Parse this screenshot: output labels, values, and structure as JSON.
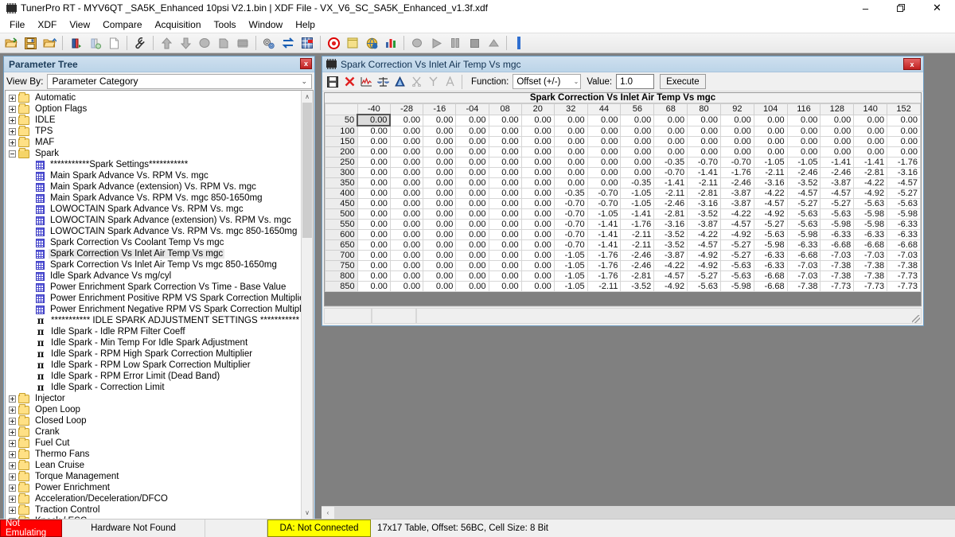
{
  "window": {
    "title": "TunerPro RT - MYV6QT  _SA5K_Enhanced 10psi V2.1.bin | XDF File - VX_V6_SC_SA5K_Enhanced_v1.3f.xdf",
    "app_icon": "chip-icon",
    "minimize_label": "–",
    "restore_label": "❐",
    "close_label": "✕"
  },
  "menu": {
    "items": [
      {
        "label": "File",
        "name": "menu-file"
      },
      {
        "label": "XDF",
        "name": "menu-xdf"
      },
      {
        "label": "View",
        "name": "menu-view"
      },
      {
        "label": "Compare",
        "name": "menu-compare"
      },
      {
        "label": "Acquisition",
        "name": "menu-acquisition"
      },
      {
        "label": "Tools",
        "name": "menu-tools"
      },
      {
        "label": "Window",
        "name": "menu-window"
      },
      {
        "label": "Help",
        "name": "menu-help"
      }
    ]
  },
  "toolbar": {
    "buttons": [
      {
        "icon": "open-folder-icon",
        "enabled": true
      },
      {
        "icon": "save-disk-icon",
        "enabled": true
      },
      {
        "icon": "save-as-folder-icon",
        "enabled": true
      },
      {
        "icon": "separator"
      },
      {
        "icon": "bin-load-icon",
        "enabled": true
      },
      {
        "icon": "bin-ghost-icon",
        "enabled": true
      },
      {
        "icon": "new-document-icon",
        "enabled": true
      },
      {
        "icon": "separator"
      },
      {
        "icon": "wrench-icon",
        "enabled": true
      },
      {
        "icon": "separator"
      },
      {
        "icon": "up-arrow-icon",
        "enabled": false
      },
      {
        "icon": "down-arrow-icon",
        "enabled": false
      },
      {
        "icon": "circle-gray-icon",
        "enabled": false
      },
      {
        "icon": "copy-gray-icon",
        "enabled": false
      },
      {
        "icon": "chip-gray-icon",
        "enabled": false
      },
      {
        "icon": "separator"
      },
      {
        "icon": "gears-icon",
        "enabled": true
      },
      {
        "icon": "swap-arrows-icon",
        "enabled": true
      },
      {
        "icon": "grid-flag-icon",
        "enabled": true
      },
      {
        "icon": "separator"
      },
      {
        "icon": "record-red-icon",
        "enabled": true
      },
      {
        "icon": "notepad-yellow-icon",
        "enabled": true
      },
      {
        "icon": "globe-icon",
        "enabled": true
      },
      {
        "icon": "bar-chart-icon",
        "enabled": true
      },
      {
        "icon": "separator"
      },
      {
        "icon": "record-gray-icon",
        "enabled": false
      },
      {
        "icon": "play-gray-icon",
        "enabled": false
      },
      {
        "icon": "pause-gray-icon",
        "enabled": false
      },
      {
        "icon": "stop-gray-icon",
        "enabled": false
      },
      {
        "icon": "eject-gray-icon",
        "enabled": false
      },
      {
        "icon": "separator"
      },
      {
        "icon": "blue-bar-icon",
        "enabled": true
      }
    ]
  },
  "parameter_tree": {
    "title": "Parameter Tree",
    "close_label": "x",
    "view_by_label": "View By:",
    "view_by_value": "Parameter Category",
    "chevron": "⌄",
    "scroll_up": "∧",
    "scroll_down": "∨",
    "nodes": [
      {
        "label": "Automatic",
        "type": "folder",
        "level": 0,
        "expander": "plus"
      },
      {
        "label": "Option Flags",
        "type": "folder",
        "level": 0,
        "expander": "plus"
      },
      {
        "label": "IDLE",
        "type": "folder",
        "level": 0,
        "expander": "plus"
      },
      {
        "label": "TPS",
        "type": "folder",
        "level": 0,
        "expander": "plus"
      },
      {
        "label": "MAF",
        "type": "folder",
        "level": 0,
        "expander": "plus"
      },
      {
        "label": "Spark",
        "type": "folder-open",
        "level": 0,
        "expander": "minus"
      },
      {
        "label": "***********Spark Settings***********",
        "type": "grid",
        "level": 1
      },
      {
        "label": "Main Spark Advance Vs. RPM Vs. mgc",
        "type": "grid",
        "level": 1
      },
      {
        "label": "Main Spark Advance (extension) Vs. RPM Vs. mgc",
        "type": "grid",
        "level": 1
      },
      {
        "label": "Main Spark Advance Vs. RPM Vs. mgc 850-1650mg",
        "type": "grid",
        "level": 1
      },
      {
        "label": "LOWOCTAIN Spark Advance Vs. RPM Vs. mgc",
        "type": "grid",
        "level": 1
      },
      {
        "label": "LOWOCTAIN Spark Advance (extension) Vs. RPM Vs. mgc",
        "type": "grid",
        "level": 1
      },
      {
        "label": "LOWOCTAIN Spark Advance Vs. RPM Vs. mgc 850-1650mg",
        "type": "grid",
        "level": 1
      },
      {
        "label": "Spark Correction Vs Coolant Temp Vs mgc",
        "type": "grid",
        "level": 1
      },
      {
        "label": "Spark Correction Vs Inlet Air Temp Vs mgc",
        "type": "grid",
        "level": 1,
        "selected": true
      },
      {
        "label": "Spark Correction Vs Inlet Air Temp Vs mgc 850-1650mg",
        "type": "grid",
        "level": 1
      },
      {
        "label": "Idle Spark Advance Vs mg/cyl",
        "type": "grid",
        "level": 1
      },
      {
        "label": "Power Enrichment Spark Correction Vs Time - Base Value",
        "type": "grid",
        "level": 1
      },
      {
        "label": "Power Enrichment Positive RPM VS Spark Correction Multiplier",
        "type": "grid",
        "level": 1
      },
      {
        "label": "Power Enrichment Negative RPM VS Spark Correction Multiplier",
        "type": "grid",
        "level": 1
      },
      {
        "label": "***********  IDLE SPARK ADJUSTMENT SETTINGS ***********",
        "type": "pi",
        "level": 1
      },
      {
        "label": "Idle Spark - Idle RPM Filter Coeff",
        "type": "pi",
        "level": 1
      },
      {
        "label": "Idle Spark - Min Temp For Idle Spark Adjustment",
        "type": "pi",
        "level": 1
      },
      {
        "label": "Idle Spark - RPM High Spark Correction Multiplier",
        "type": "pi",
        "level": 1
      },
      {
        "label": "Idle Spark - RPM Low Spark Correction Multiplier",
        "type": "pi",
        "level": 1
      },
      {
        "label": "Idle Spark - RPM Error Limit (Dead Band)",
        "type": "pi",
        "level": 1
      },
      {
        "label": "Idle Spark - Correction Limit",
        "type": "pi",
        "level": 1
      },
      {
        "label": "Injector",
        "type": "folder",
        "level": 0,
        "expander": "plus"
      },
      {
        "label": "Open Loop",
        "type": "folder",
        "level": 0,
        "expander": "plus"
      },
      {
        "label": "Closed Loop",
        "type": "folder",
        "level": 0,
        "expander": "plus"
      },
      {
        "label": "Crank",
        "type": "folder",
        "level": 0,
        "expander": "plus"
      },
      {
        "label": "Fuel Cut",
        "type": "folder",
        "level": 0,
        "expander": "plus"
      },
      {
        "label": "Thermo Fans",
        "type": "folder",
        "level": 0,
        "expander": "plus"
      },
      {
        "label": "Lean Cruise",
        "type": "folder",
        "level": 0,
        "expander": "plus"
      },
      {
        "label": "Torque Management",
        "type": "folder",
        "level": 0,
        "expander": "plus"
      },
      {
        "label": "Power Enrichment",
        "type": "folder",
        "level": 0,
        "expander": "plus"
      },
      {
        "label": "Acceleration/Deceleration/DFCO",
        "type": "folder",
        "level": 0,
        "expander": "plus"
      },
      {
        "label": "Traction Control",
        "type": "folder",
        "level": 0,
        "expander": "plus"
      },
      {
        "label": "Knock / ESC",
        "type": "folder",
        "level": 0,
        "expander": "plus"
      }
    ]
  },
  "table_window": {
    "title": "Spark Correction Vs Inlet Air Temp Vs mgc",
    "close_label": "x",
    "toolbar": {
      "save_icon": "save-disk-icon",
      "close_x_icon": "red-x-icon",
      "graph_icon": "red-graph-icon",
      "scale_icon": "balance-scale-icon",
      "compare_icon": "blue-triangle-icon",
      "cut_icon": "cut-gray-icon",
      "interp_icon": "interpolate-gray-icon",
      "font_icon": "font-a-gray-icon",
      "function_label": "Function:",
      "function_value": "Offset (+/-)",
      "function_chevron": "⌄",
      "value_label": "Value:",
      "value_input": "1.0",
      "execute_label": "Execute"
    },
    "caption": "Spark Correction Vs Inlet Air Temp Vs mgc",
    "active_cell": {
      "row": 0,
      "col": 0
    }
  },
  "chart_data": {
    "type": "table",
    "title": "Spark Correction Vs Inlet Air Temp Vs mgc",
    "xlabel": "Inlet Air Temp",
    "ylabel": "mgc",
    "columns": [
      "-40",
      "-28",
      "-16",
      "-04",
      "08",
      "20",
      "32",
      "44",
      "56",
      "68",
      "80",
      "92",
      "104",
      "116",
      "128",
      "140",
      "152"
    ],
    "rows": [
      "50",
      "100",
      "150",
      "200",
      "250",
      "300",
      "350",
      "400",
      "450",
      "500",
      "550",
      "600",
      "650",
      "700",
      "750",
      "800",
      "850"
    ],
    "values": [
      [
        "0.00",
        "0.00",
        "0.00",
        "0.00",
        "0.00",
        "0.00",
        "0.00",
        "0.00",
        "0.00",
        "0.00",
        "0.00",
        "0.00",
        "0.00",
        "0.00",
        "0.00",
        "0.00",
        "0.00"
      ],
      [
        "0.00",
        "0.00",
        "0.00",
        "0.00",
        "0.00",
        "0.00",
        "0.00",
        "0.00",
        "0.00",
        "0.00",
        "0.00",
        "0.00",
        "0.00",
        "0.00",
        "0.00",
        "0.00",
        "0.00"
      ],
      [
        "0.00",
        "0.00",
        "0.00",
        "0.00",
        "0.00",
        "0.00",
        "0.00",
        "0.00",
        "0.00",
        "0.00",
        "0.00",
        "0.00",
        "0.00",
        "0.00",
        "0.00",
        "0.00",
        "0.00"
      ],
      [
        "0.00",
        "0.00",
        "0.00",
        "0.00",
        "0.00",
        "0.00",
        "0.00",
        "0.00",
        "0.00",
        "0.00",
        "0.00",
        "0.00",
        "0.00",
        "0.00",
        "0.00",
        "0.00",
        "0.00"
      ],
      [
        "0.00",
        "0.00",
        "0.00",
        "0.00",
        "0.00",
        "0.00",
        "0.00",
        "0.00",
        "0.00",
        "-0.35",
        "-0.70",
        "-0.70",
        "-1.05",
        "-1.05",
        "-1.41",
        "-1.41",
        "-1.76"
      ],
      [
        "0.00",
        "0.00",
        "0.00",
        "0.00",
        "0.00",
        "0.00",
        "0.00",
        "0.00",
        "0.00",
        "-0.70",
        "-1.41",
        "-1.76",
        "-2.11",
        "-2.46",
        "-2.46",
        "-2.81",
        "-3.16"
      ],
      [
        "0.00",
        "0.00",
        "0.00",
        "0.00",
        "0.00",
        "0.00",
        "0.00",
        "0.00",
        "-0.35",
        "-1.41",
        "-2.11",
        "-2.46",
        "-3.16",
        "-3.52",
        "-3.87",
        "-4.22",
        "-4.57"
      ],
      [
        "0.00",
        "0.00",
        "0.00",
        "0.00",
        "0.00",
        "0.00",
        "-0.35",
        "-0.70",
        "-1.05",
        "-2.11",
        "-2.81",
        "-3.87",
        "-4.22",
        "-4.57",
        "-4.57",
        "-4.92",
        "-5.27"
      ],
      [
        "0.00",
        "0.00",
        "0.00",
        "0.00",
        "0.00",
        "0.00",
        "-0.70",
        "-0.70",
        "-1.05",
        "-2.46",
        "-3.16",
        "-3.87",
        "-4.57",
        "-5.27",
        "-5.27",
        "-5.63",
        "-5.63"
      ],
      [
        "0.00",
        "0.00",
        "0.00",
        "0.00",
        "0.00",
        "0.00",
        "-0.70",
        "-1.05",
        "-1.41",
        "-2.81",
        "-3.52",
        "-4.22",
        "-4.92",
        "-5.63",
        "-5.63",
        "-5.98",
        "-5.98"
      ],
      [
        "0.00",
        "0.00",
        "0.00",
        "0.00",
        "0.00",
        "0.00",
        "-0.70",
        "-1.41",
        "-1.76",
        "-3.16",
        "-3.87",
        "-4.57",
        "-5.27",
        "-5.63",
        "-5.98",
        "-5.98",
        "-6.33"
      ],
      [
        "0.00",
        "0.00",
        "0.00",
        "0.00",
        "0.00",
        "0.00",
        "-0.70",
        "-1.41",
        "-2.11",
        "-3.52",
        "-4.22",
        "-4.92",
        "-5.63",
        "-5.98",
        "-6.33",
        "-6.33",
        "-6.33"
      ],
      [
        "0.00",
        "0.00",
        "0.00",
        "0.00",
        "0.00",
        "0.00",
        "-0.70",
        "-1.41",
        "-2.11",
        "-3.52",
        "-4.57",
        "-5.27",
        "-5.98",
        "-6.33",
        "-6.68",
        "-6.68",
        "-6.68"
      ],
      [
        "0.00",
        "0.00",
        "0.00",
        "0.00",
        "0.00",
        "0.00",
        "-1.05",
        "-1.76",
        "-2.46",
        "-3.87",
        "-4.92",
        "-5.27",
        "-6.33",
        "-6.68",
        "-7.03",
        "-7.03",
        "-7.03"
      ],
      [
        "0.00",
        "0.00",
        "0.00",
        "0.00",
        "0.00",
        "0.00",
        "-1.05",
        "-1.76",
        "-2.46",
        "-4.22",
        "-4.92",
        "-5.63",
        "-6.33",
        "-7.03",
        "-7.38",
        "-7.38",
        "-7.38"
      ],
      [
        "0.00",
        "0.00",
        "0.00",
        "0.00",
        "0.00",
        "0.00",
        "-1.05",
        "-1.76",
        "-2.81",
        "-4.57",
        "-5.27",
        "-5.63",
        "-6.68",
        "-7.03",
        "-7.38",
        "-7.38",
        "-7.73"
      ],
      [
        "0.00",
        "0.00",
        "0.00",
        "0.00",
        "0.00",
        "0.00",
        "-1.05",
        "-2.11",
        "-3.52",
        "-4.92",
        "-5.63",
        "-5.98",
        "-6.68",
        "-7.38",
        "-7.73",
        "-7.73",
        "-7.73"
      ]
    ]
  },
  "table_status": {
    "cells": [
      "",
      "",
      ""
    ]
  },
  "hscroll": {
    "left_arrow": "‹",
    "right_arrow": "›"
  },
  "statusbar": {
    "emulating": "Not Emulating",
    "hardware": "Hardware Not Found",
    "blank": "",
    "da": "DA: Not Connected",
    "info": "17x17 Table, Offset: 56BC,  Cell Size: 8 Bit"
  },
  "colors": {
    "error_red": "#ff0000",
    "warn_yellow": "#ffff00",
    "window_border": "#6f9ec4",
    "title_gradient_top": "#cfe0ef",
    "workspace": "#808080"
  }
}
